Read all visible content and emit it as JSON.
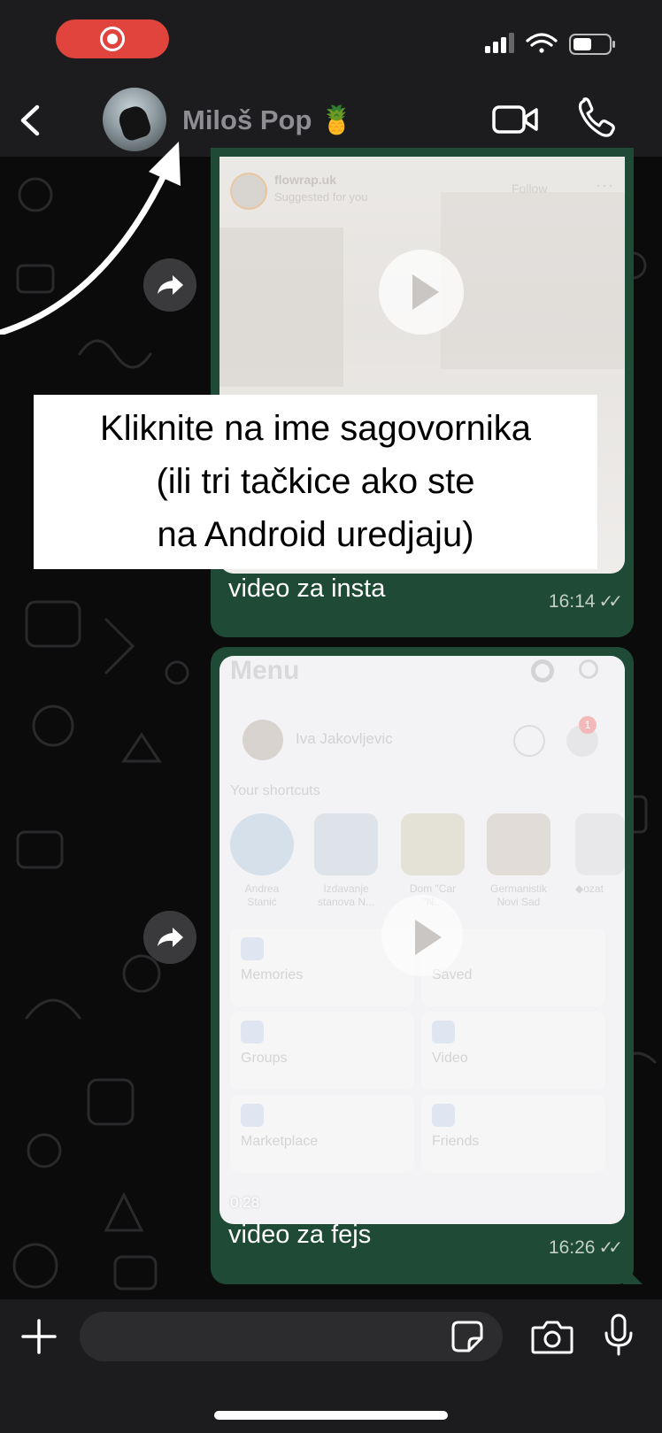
{
  "status_bar": {
    "recording_indicator": "screen-recording-icon",
    "icons": [
      "cellular-signal-icon",
      "wifi-icon",
      "battery-icon"
    ]
  },
  "header": {
    "back_icon": "chevron-left-icon",
    "contact_name": "Miloš Pop 🍍",
    "actions": [
      "video-call-icon",
      "phone-icon"
    ]
  },
  "messages": [
    {
      "preview": {
        "account": "flowrap.uk",
        "subtitle": "Suggested for you",
        "follow": "Follow",
        "more": "···"
      },
      "caption": "video za insta",
      "time": "16:14",
      "ticks": "✓✓"
    },
    {
      "preview": {
        "title": "Menu",
        "profile_name": "Iva Jakovljevic",
        "badge": "1",
        "shortcuts_label": "Your shortcuts",
        "shortcuts": [
          "Andrea\nStanić",
          "Izdavanje\nstanova N...",
          "Dom \"Car\n\"N...",
          "Germanistik\nNovi Sad",
          "◆ozat"
        ],
        "tiles": [
          "Memories",
          "Saved",
          "Groups",
          "Video",
          "Marketplace",
          "Friends"
        ],
        "duration": "0:28"
      },
      "caption": "video za fejs",
      "time": "16:26",
      "ticks": "✓✓"
    }
  ],
  "annotation": {
    "lines": [
      "Kliknite na ime sagovornika",
      "(ili tri tačkice ako ste",
      "na Android uredjaju)"
    ]
  },
  "composer": {
    "placeholder": "",
    "icons": [
      "plus-icon",
      "sticker-icon",
      "camera-icon",
      "microphone-icon"
    ]
  },
  "colors": {
    "bubble_outgoing": "#1f4a35",
    "recording_pill": "#e0443c",
    "bar_background": "#1c1c1e"
  }
}
